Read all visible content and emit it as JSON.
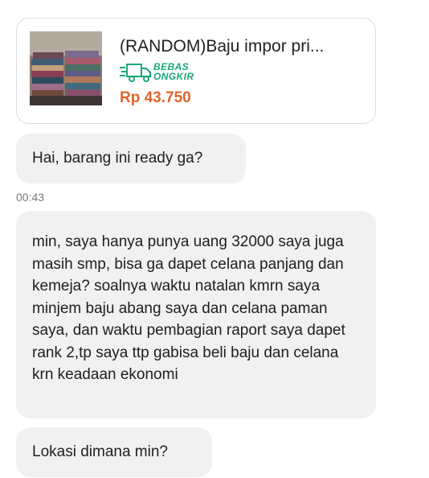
{
  "product": {
    "title": "(RANDOM)Baju impor pri...",
    "shipping_line1": "BEBAS",
    "shipping_line2": "ONGKIR",
    "price": "Rp 43.750",
    "thumbnail_icon": "clothes-pile-image"
  },
  "messages": [
    {
      "text": "Hai, barang ini ready ga?"
    },
    {
      "text": "min, saya hanya punya uang 32000 saya juga masih smp, bisa ga dapet celana panjang dan kemeja? soalnya waktu natalan kmrn saya minjem baju abang saya dan celana paman saya, dan waktu pembagian raport saya dapet rank 2,tp saya ttp gabisa beli baju dan celana krn keadaan ekonomi"
    },
    {
      "text": "Lokasi dimana min?"
    }
  ],
  "timestamp": "00:43",
  "colors": {
    "price": "#e0652c",
    "free_shipping": "#1aa776",
    "bubble": "#f1f1f1"
  }
}
